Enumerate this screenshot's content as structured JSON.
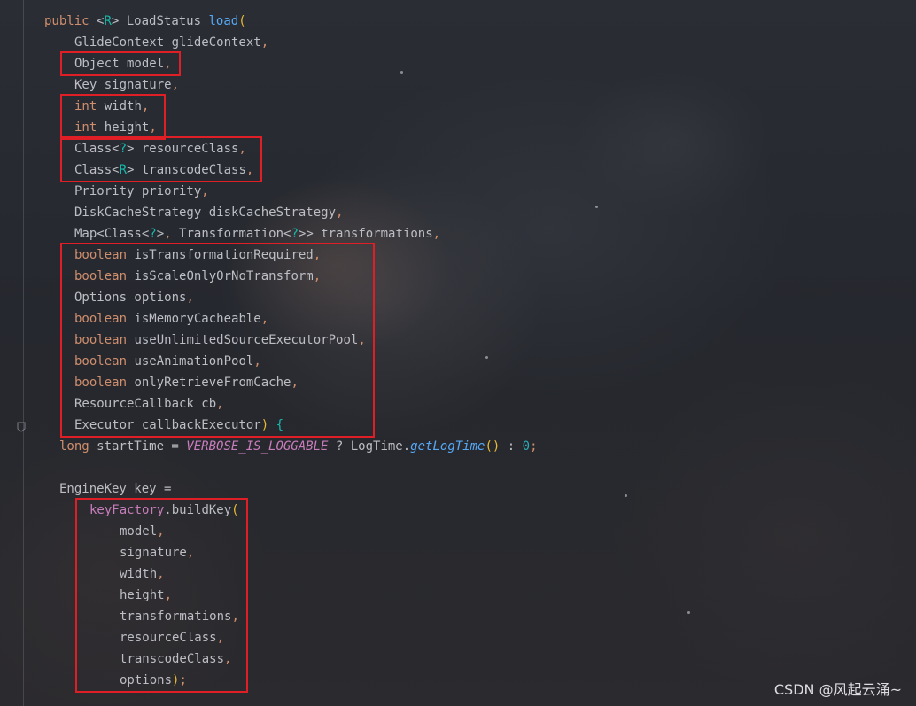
{
  "code_lines": [
    {
      "indent": 0,
      "tokens": [
        {
          "t": "public ",
          "c": "kw"
        },
        {
          "t": "<",
          "c": "ty"
        },
        {
          "t": "R",
          "c": "gen"
        },
        {
          "t": "> LoadStatus ",
          "c": "ty"
        },
        {
          "t": "load",
          "c": "fn"
        },
        {
          "t": "(",
          "c": "brace"
        }
      ]
    },
    {
      "indent": 1,
      "tokens": [
        {
          "t": "GlideContext glideContext",
          "c": "ty"
        },
        {
          "t": ",",
          "c": "comma"
        }
      ]
    },
    {
      "indent": 1,
      "tokens": [
        {
          "t": "Object model",
          "c": "ty"
        },
        {
          "t": ",",
          "c": "comma"
        }
      ]
    },
    {
      "indent": 1,
      "tokens": [
        {
          "t": "Key signature",
          "c": "ty"
        },
        {
          "t": ",",
          "c": "comma"
        }
      ]
    },
    {
      "indent": 1,
      "tokens": [
        {
          "t": "int",
          "c": "kw"
        },
        {
          "t": " width",
          "c": "ty"
        },
        {
          "t": ",",
          "c": "comma"
        }
      ]
    },
    {
      "indent": 1,
      "tokens": [
        {
          "t": "int",
          "c": "kw"
        },
        {
          "t": " height",
          "c": "ty"
        },
        {
          "t": ",",
          "c": "comma"
        }
      ]
    },
    {
      "indent": 1,
      "tokens": [
        {
          "t": "Class<",
          "c": "ty"
        },
        {
          "t": "?",
          "c": "gen"
        },
        {
          "t": "> resourceClass",
          "c": "ty"
        },
        {
          "t": ",",
          "c": "comma"
        }
      ]
    },
    {
      "indent": 1,
      "tokens": [
        {
          "t": "Class<",
          "c": "ty"
        },
        {
          "t": "R",
          "c": "gen"
        },
        {
          "t": "> transcodeClass",
          "c": "ty"
        },
        {
          "t": ",",
          "c": "comma"
        }
      ]
    },
    {
      "indent": 1,
      "tokens": [
        {
          "t": "Priority priority",
          "c": "ty"
        },
        {
          "t": ",",
          "c": "comma"
        }
      ]
    },
    {
      "indent": 1,
      "tokens": [
        {
          "t": "DiskCacheStrategy diskCacheStrategy",
          "c": "ty"
        },
        {
          "t": ",",
          "c": "comma"
        }
      ]
    },
    {
      "indent": 1,
      "tokens": [
        {
          "t": "Map<Class<",
          "c": "ty"
        },
        {
          "t": "?",
          "c": "gen"
        },
        {
          "t": ">",
          "c": "ty"
        },
        {
          "t": ",",
          "c": "comma"
        },
        {
          "t": " Transformation<",
          "c": "ty"
        },
        {
          "t": "?",
          "c": "gen"
        },
        {
          "t": ">> transformations",
          "c": "ty"
        },
        {
          "t": ",",
          "c": "comma"
        }
      ]
    },
    {
      "indent": 1,
      "tokens": [
        {
          "t": "boolean",
          "c": "kw"
        },
        {
          "t": " isTransformationRequired",
          "c": "ty"
        },
        {
          "t": ",",
          "c": "comma"
        }
      ]
    },
    {
      "indent": 1,
      "tokens": [
        {
          "t": "boolean",
          "c": "kw"
        },
        {
          "t": " isScaleOnlyOrNoTransform",
          "c": "ty"
        },
        {
          "t": ",",
          "c": "comma"
        }
      ]
    },
    {
      "indent": 1,
      "tokens": [
        {
          "t": "Options options",
          "c": "ty"
        },
        {
          "t": ",",
          "c": "comma"
        }
      ]
    },
    {
      "indent": 1,
      "tokens": [
        {
          "t": "boolean",
          "c": "kw"
        },
        {
          "t": " isMemoryCacheable",
          "c": "ty"
        },
        {
          "t": ",",
          "c": "comma"
        }
      ]
    },
    {
      "indent": 1,
      "tokens": [
        {
          "t": "boolean",
          "c": "kw"
        },
        {
          "t": " useUnlimitedSourceExecutorPool",
          "c": "ty"
        },
        {
          "t": ",",
          "c": "comma"
        }
      ]
    },
    {
      "indent": 1,
      "tokens": [
        {
          "t": "boolean",
          "c": "kw"
        },
        {
          "t": " useAnimationPool",
          "c": "ty"
        },
        {
          "t": ",",
          "c": "comma"
        }
      ]
    },
    {
      "indent": 1,
      "tokens": [
        {
          "t": "boolean",
          "c": "kw"
        },
        {
          "t": " onlyRetrieveFromCache",
          "c": "ty"
        },
        {
          "t": ",",
          "c": "comma"
        }
      ]
    },
    {
      "indent": 1,
      "tokens": [
        {
          "t": "ResourceCallback cb",
          "c": "ty"
        },
        {
          "t": ",",
          "c": "comma"
        }
      ]
    },
    {
      "indent": 1,
      "tokens": [
        {
          "t": "Executor callbackExecutor",
          "c": "ty"
        },
        {
          "t": ")",
          "c": "brace"
        },
        {
          "t": " {",
          "c": "gen"
        }
      ]
    },
    {
      "indent": 0.5,
      "tokens": [
        {
          "t": "long",
          "c": "kw"
        },
        {
          "t": " startTime = ",
          "c": "ty"
        },
        {
          "t": "VERBOSE_IS_LOGGABLE",
          "c": "const"
        },
        {
          "t": " ? LogTime.",
          "c": "ty"
        },
        {
          "t": "getLogTime",
          "c": "static-fn"
        },
        {
          "t": "()",
          "c": "brace"
        },
        {
          "t": " : ",
          "c": "ty"
        },
        {
          "t": "0",
          "c": "num"
        },
        {
          "t": ";",
          "c": "comma"
        }
      ]
    },
    {
      "indent": 0.5,
      "tokens": []
    },
    {
      "indent": 0.5,
      "tokens": [
        {
          "t": "EngineKey key =",
          "c": "ty"
        }
      ]
    },
    {
      "indent": 1.5,
      "tokens": [
        {
          "t": "keyFactory",
          "c": "field"
        },
        {
          "t": ".buildKey",
          "c": "ty"
        },
        {
          "t": "(",
          "c": "brace"
        }
      ]
    },
    {
      "indent": 2.5,
      "tokens": [
        {
          "t": "model",
          "c": "ty"
        },
        {
          "t": ",",
          "c": "comma"
        }
      ]
    },
    {
      "indent": 2.5,
      "tokens": [
        {
          "t": "signature",
          "c": "ty"
        },
        {
          "t": ",",
          "c": "comma"
        }
      ]
    },
    {
      "indent": 2.5,
      "tokens": [
        {
          "t": "width",
          "c": "ty"
        },
        {
          "t": ",",
          "c": "comma"
        }
      ]
    },
    {
      "indent": 2.5,
      "tokens": [
        {
          "t": "height",
          "c": "ty"
        },
        {
          "t": ",",
          "c": "comma"
        }
      ]
    },
    {
      "indent": 2.5,
      "tokens": [
        {
          "t": "transformations",
          "c": "ty"
        },
        {
          "t": ",",
          "c": "comma"
        }
      ]
    },
    {
      "indent": 2.5,
      "tokens": [
        {
          "t": "resourceClass",
          "c": "ty"
        },
        {
          "t": ",",
          "c": "comma"
        }
      ]
    },
    {
      "indent": 2.5,
      "tokens": [
        {
          "t": "transcodeClass",
          "c": "ty"
        },
        {
          "t": ",",
          "c": "comma"
        }
      ]
    },
    {
      "indent": 2.5,
      "tokens": [
        {
          "t": "options",
          "c": "ty"
        },
        {
          "t": ")",
          "c": "brace"
        },
        {
          "t": ";",
          "c": "comma"
        }
      ]
    }
  ],
  "highlight_groups": [
    {
      "name": "model-param",
      "first_line": 2,
      "last_line": 2
    },
    {
      "name": "size-params",
      "first_line": 4,
      "last_line": 5
    },
    {
      "name": "class-params",
      "first_line": 6,
      "last_line": 7
    },
    {
      "name": "flag-params",
      "first_line": 11,
      "last_line": 19
    },
    {
      "name": "buildkey-call",
      "first_line": 23,
      "last_line": 31
    }
  ],
  "colors": {
    "keyword": "#cf8e6d",
    "text": "#bcbec4",
    "generic": "#16baac",
    "function": "#56a8f5",
    "highlight_box": "#e01e25"
  },
  "gutter_icon": "fold-marker-icon",
  "watermark": "CSDN @风起云涌~"
}
